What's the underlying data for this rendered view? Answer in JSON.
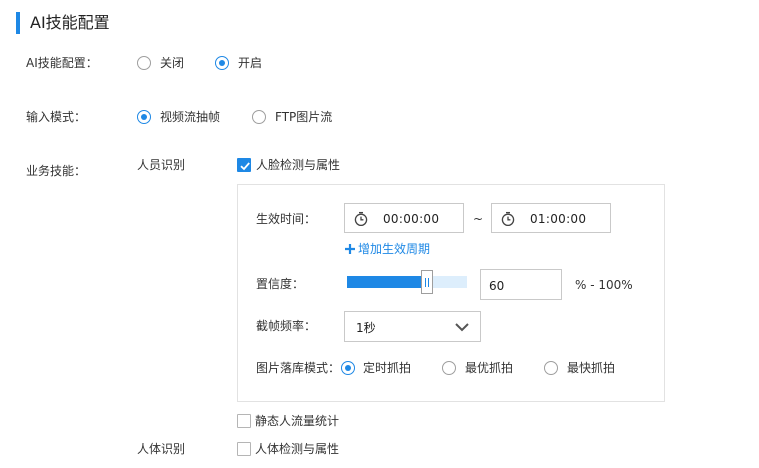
{
  "section": {
    "title": "AI技能配置"
  },
  "ai_config": {
    "label": "AI技能配置：",
    "options": [
      "关闭",
      "开启"
    ],
    "selected": "开启"
  },
  "input_mode": {
    "label": "输入模式：",
    "options": [
      "视频流抽帧",
      "FTP图片流"
    ],
    "selected": "视频流抽帧"
  },
  "business_skill": {
    "label": "业务技能：",
    "person_recognition": {
      "label": "人员识别",
      "face_detection": {
        "label": "人脸检测与属性",
        "checked": true
      },
      "static_flow": {
        "label": "静态人流量统计",
        "checked": false
      }
    },
    "body_recognition": {
      "label": "人体识别",
      "body_detection": {
        "label": "人体检测与属性",
        "checked": false
      }
    }
  },
  "face_settings": {
    "effective_time": {
      "label": "生效时间：",
      "start": "00:00:00",
      "separator": "~",
      "end": "01:00:00",
      "add_period": "增加生效周期"
    },
    "confidence": {
      "label": "置信度：",
      "slider_fraction": 0.6,
      "value": "60",
      "suffix": "% - 100%"
    },
    "frame_rate": {
      "label": "截帧频率：",
      "value": "1秒"
    },
    "storage_mode": {
      "label": "图片落库模式：",
      "options": [
        "定时抓拍",
        "最优抓拍",
        "最快抓拍"
      ],
      "selected": "定时抓拍"
    }
  },
  "colors": {
    "accent": "#1e88e5",
    "border": "#c9c9c9"
  },
  "icons": [
    "clock-icon",
    "plus-icon",
    "chevron-down-icon",
    "checkmark-icon"
  ]
}
